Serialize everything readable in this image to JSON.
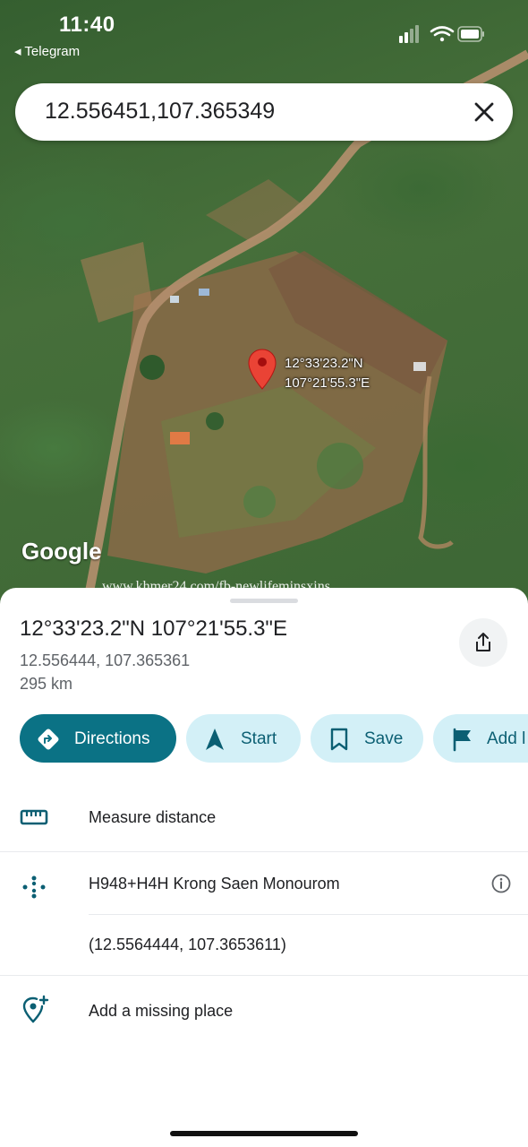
{
  "status_bar": {
    "time": "11:40",
    "back_app": "◂ Telegram"
  },
  "search": {
    "value": "12.556451,107.365349"
  },
  "map": {
    "pin_label_lat": "12°33'23.2\"N",
    "pin_label_lng": "107°21'55.3\"E",
    "brand": "Google",
    "watermark": "www.khmer24.com/fb-newlifeminsxins"
  },
  "place": {
    "title": "12°33'23.2\"N 107°21'55.3\"E",
    "decimal_coords": "12.556444, 107.365361",
    "distance": "295 km"
  },
  "actions": [
    {
      "label": "Directions",
      "icon": "directions-icon"
    },
    {
      "label": "Start",
      "icon": "navigation-arrow-icon"
    },
    {
      "label": "Save",
      "icon": "bookmark-icon"
    },
    {
      "label": "Add l",
      "icon": "flag-icon"
    }
  ],
  "rows": {
    "measure": "Measure distance",
    "plus_code": "H948+H4H Krong Saen Monourom",
    "precise_coords": "(12.5564444, 107.3653611)",
    "add_place": "Add a missing place"
  },
  "colors": {
    "accent": "#0b7285",
    "chip_bg": "#d3f0f7",
    "chip_text": "#0b5f73",
    "pin_red": "#ea4335"
  }
}
